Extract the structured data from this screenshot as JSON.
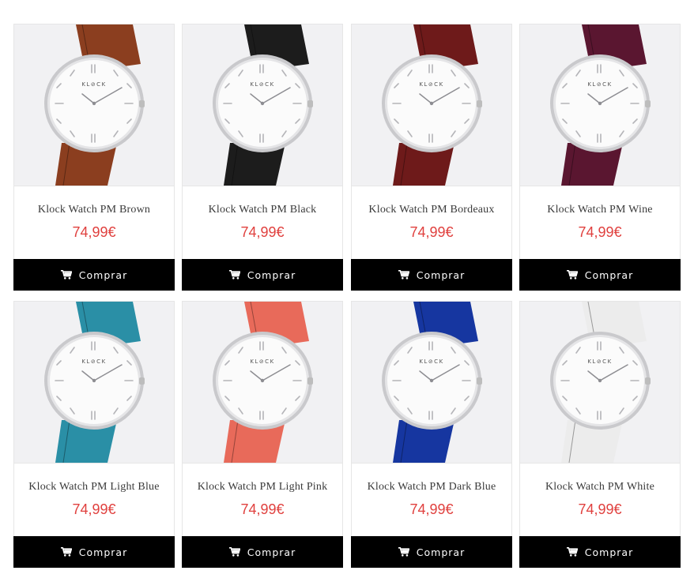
{
  "products": [
    {
      "name": "Klock Watch PM Brown",
      "price": "74,99€",
      "button": "Comprar",
      "strap_color": "#8b3e1f",
      "brand": "KL⊘CK"
    },
    {
      "name": "Klock Watch PM Black",
      "price": "74,99€",
      "button": "Comprar",
      "strap_color": "#1c1c1c",
      "brand": "KL⊘CK"
    },
    {
      "name": "Klock Watch PM Bordeaux",
      "price": "74,99€",
      "button": "Comprar",
      "strap_color": "#6e1a1a",
      "brand": "KL⊘CK"
    },
    {
      "name": "Klock Watch PM Wine",
      "price": "74,99€",
      "button": "Comprar",
      "strap_color": "#5a1630",
      "brand": "KL⊘CK"
    },
    {
      "name": "Klock Watch PM Light Blue",
      "price": "74,99€",
      "button": "Comprar",
      "strap_color": "#2a8fa6",
      "brand": "KL⊘CK"
    },
    {
      "name": "Klock Watch PM Light Pink",
      "price": "74,99€",
      "button": "Comprar",
      "strap_color": "#e86a5a",
      "brand": "KL⊘CK"
    },
    {
      "name": "Klock Watch PM Dark Blue",
      "price": "74,99€",
      "button": "Comprar",
      "strap_color": "#1636a0",
      "brand": "KL⊘CK"
    },
    {
      "name": "Klock Watch PM White",
      "price": "74,99€",
      "button": "Comprar",
      "strap_color": "#ececec",
      "brand": "KL⊘CK"
    }
  ],
  "icons": {
    "buy_icon": "shopping-cart-icon"
  },
  "colors": {
    "price": "#e0403e",
    "button_bg": "#000000",
    "button_text": "#ffffff"
  }
}
